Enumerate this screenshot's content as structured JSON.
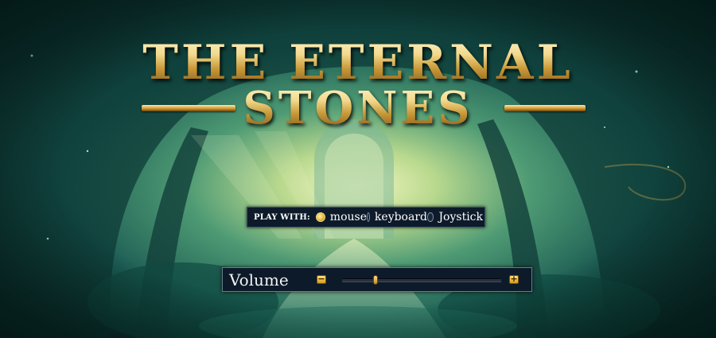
{
  "title": {
    "line1": "THE ETERNAL",
    "line2": "STONES"
  },
  "play": {
    "label": "PLAY WITH:",
    "options": [
      {
        "label": "mouse",
        "selected": true
      },
      {
        "label": "keyboard",
        "selected": false
      },
      {
        "label": "Joystick",
        "selected": false
      }
    ]
  },
  "volume": {
    "label": "Volume",
    "minus_icon": "minus-icon",
    "plus_icon": "plus-icon",
    "level": 0.21
  },
  "colors": {
    "gold": "#e6b73c",
    "panel": "#0d1a2a",
    "forest": "#0b2e2c"
  }
}
